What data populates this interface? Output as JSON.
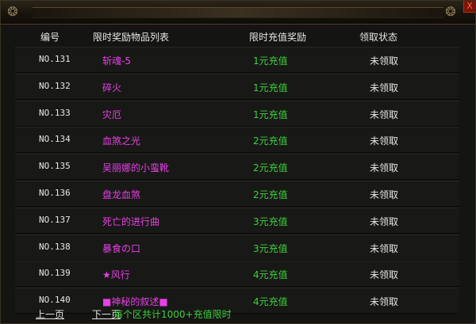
{
  "window": {
    "close_label": "X"
  },
  "header": {
    "col_no": "编号",
    "col_item": "限时奖励物品列表",
    "col_prize": "限时充值奖励",
    "col_status": "领取状态"
  },
  "rows": [
    {
      "no": "NO.131",
      "item": "斩魂-5",
      "prize": "1元充值",
      "status": "未领取"
    },
    {
      "no": "NO.132",
      "item": "碎火",
      "prize": "1元充值",
      "status": "未领取"
    },
    {
      "no": "NO.133",
      "item": "灾厄",
      "prize": "1元充值",
      "status": "未领取"
    },
    {
      "no": "NO.134",
      "item": "血煞之光",
      "prize": "2元充值",
      "status": "未领取"
    },
    {
      "no": "NO.135",
      "item": "吴丽娜的小蛮靴",
      "prize": "2元充值",
      "status": "未领取"
    },
    {
      "no": "NO.136",
      "item": "盘龙血煞",
      "prize": "2元充值",
      "status": "未领取"
    },
    {
      "no": "NO.137",
      "item": "死亡的进行曲",
      "prize": "3元充值",
      "status": "未领取"
    },
    {
      "no": "NO.138",
      "item": "暴食の口",
      "prize": "3元充值",
      "status": "未领取"
    },
    {
      "no": "NO.139",
      "item": "★风行",
      "prize": "4元充值",
      "status": "未领取"
    },
    {
      "no": "NO.140",
      "item": "■神秘的叙述■",
      "prize": "4元充值",
      "status": "未领取"
    }
  ],
  "footer": {
    "prev": "上一页",
    "next": "下一页",
    "note": "每个区共计1000+充值限时"
  },
  "colors": {
    "item": "#e840e8",
    "prize": "#3ed23e",
    "text": "#e6e6e6"
  }
}
